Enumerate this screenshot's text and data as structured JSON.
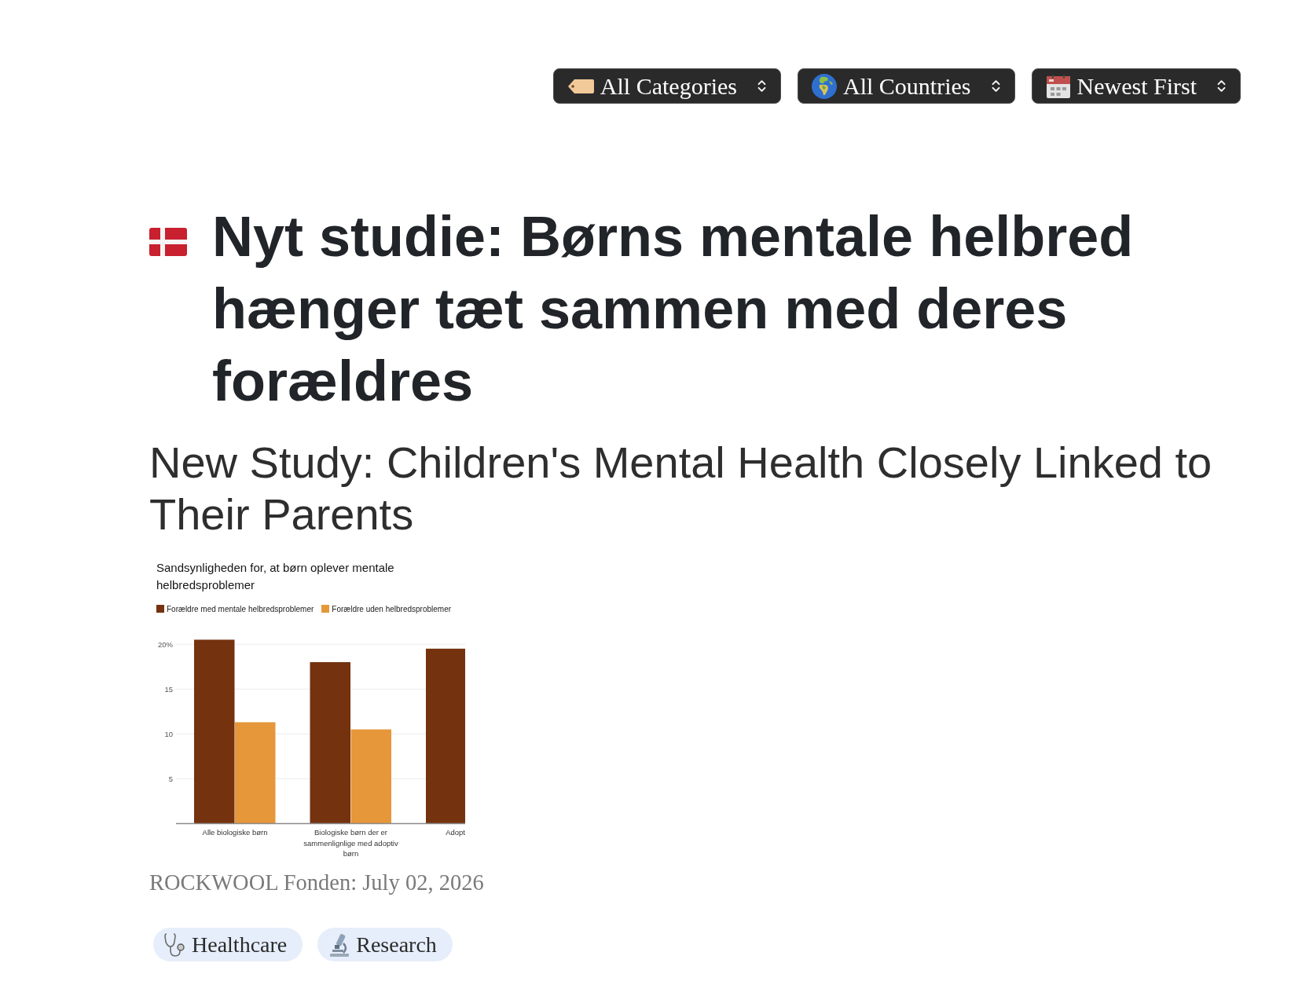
{
  "filters": [
    {
      "label": "All Categories"
    },
    {
      "label": "All Countries"
    },
    {
      "label": "Newest First"
    }
  ],
  "article": {
    "title": "Nyt studie: Børns mentale helbred hænger tæt sammen med deres forældres",
    "subtitle": "New Study: Children's Mental Health Closely Linked to Their Parents",
    "figure": {
      "chart_data": {
        "type": "bar",
        "title": "Sandsynligheden for, at børn oplever mentale helbredsproblemer",
        "categories": [
          "Alle biologiske børn",
          "Biologiske børn der er sammenlignlige med adoptiv børn",
          "Adopt"
        ],
        "series": [
          {
            "name": "Forældre med mentale helbredsproblemer",
            "color": "#74320f",
            "values": [
              20.5,
              18.0,
              19.5
            ]
          },
          {
            "name": "Forældre uden helbredsproblemer",
            "color": "#e5973a",
            "values": [
              11.3,
              10.5,
              null
            ]
          }
        ],
        "ylim": [
          0,
          20.5
        ],
        "yticks": [
          5,
          10,
          15,
          {
            "value": 20,
            "label": "20%"
          }
        ],
        "grid": true,
        "legend": true
      }
    },
    "source": "ROCKWOOL Fonden: July 02, 2026",
    "tags": [
      {
        "label": "Healthcare"
      },
      {
        "label": "Research"
      }
    ]
  }
}
